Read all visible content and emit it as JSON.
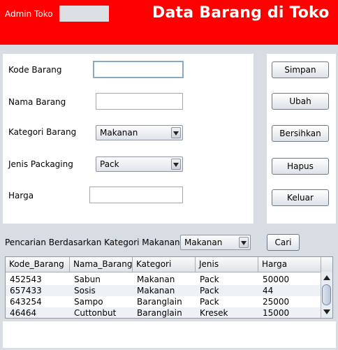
{
  "header": {
    "admin_label": "Admin Toko",
    "title": "Data Barang di Toko",
    "bg_color": "#fe0000"
  },
  "form": {
    "kode_label": "Kode Barang",
    "kode_value": "",
    "nama_label": "Nama Barang",
    "nama_value": "",
    "kategori_label": "Kategori Barang",
    "kategori_value": "Makanan",
    "packaging_label": "Jenis Packaging",
    "packaging_value": "Pack",
    "harga_label": "Harga",
    "harga_value": ""
  },
  "buttons": {
    "simpan": "Simpan",
    "ubah": "Ubah",
    "bersihkan": "Bersihkan",
    "hapus": "Hapus",
    "keluar": "Keluar"
  },
  "search": {
    "label": "Pencarian Berdasarkan Kategori Makanan",
    "value": "Makanan",
    "button": "Cari"
  },
  "table": {
    "columns": [
      "Kode_Barang",
      "Nama_Barang",
      "Kategori",
      "Jenis",
      "Harga"
    ],
    "rows": [
      [
        "452543",
        "Sabun",
        "Makanan",
        "Pack",
        "50000"
      ],
      [
        "657433",
        "Sosis",
        "Makanan",
        "Pack",
        "44"
      ],
      [
        "643254",
        "Sampo",
        "Baranglain",
        "Pack",
        "25000"
      ],
      [
        "46464",
        "Cuttonbut",
        "Baranglain",
        "Kresek",
        "15000"
      ]
    ]
  }
}
